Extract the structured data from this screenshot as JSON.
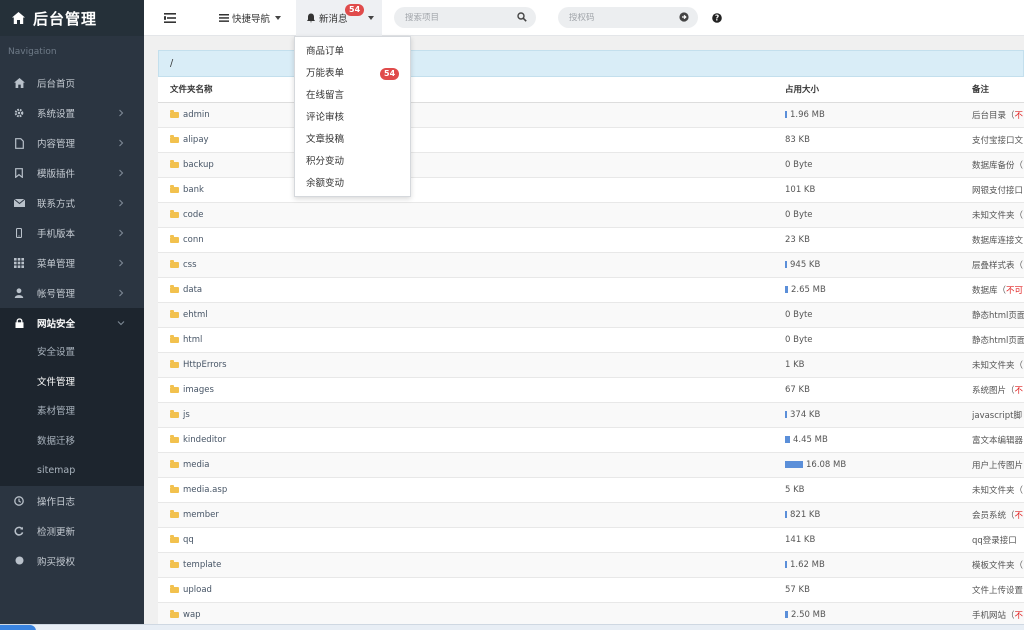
{
  "brand": {
    "title": "后台管理",
    "icon": "home-icon"
  },
  "sidebar": {
    "caption": "Navigation",
    "items": [
      {
        "label": "后台首页",
        "icon": "home-icon",
        "chevron": false
      },
      {
        "label": "系统设置",
        "icon": "gear-icon",
        "chevron": true
      },
      {
        "label": "内容管理",
        "icon": "document-icon",
        "chevron": true
      },
      {
        "label": "模版插件",
        "icon": "bookmark-icon",
        "chevron": true
      },
      {
        "label": "联系方式",
        "icon": "envelope-icon",
        "chevron": true
      },
      {
        "label": "手机版本",
        "icon": "mobile-icon",
        "chevron": true
      },
      {
        "label": "菜单管理",
        "icon": "grid-icon",
        "chevron": true
      },
      {
        "label": "帐号管理",
        "icon": "user-icon",
        "chevron": true
      },
      {
        "label": "网站安全",
        "icon": "lock-icon",
        "chevron": true,
        "active": true
      }
    ],
    "submenu": [
      {
        "label": "安全设置"
      },
      {
        "label": "文件管理",
        "current": true
      },
      {
        "label": "素材管理"
      },
      {
        "label": "数据迁移"
      },
      {
        "label": "sitemap"
      }
    ],
    "bottom_items": [
      {
        "label": "操作日志",
        "icon": "clock-icon"
      },
      {
        "label": "检测更新",
        "icon": "refresh-icon"
      },
      {
        "label": "购买授权",
        "icon": "circle-icon"
      }
    ]
  },
  "topbar": {
    "quicknav_label": "快捷导航",
    "messages_label": "新消息",
    "messages_count": "54",
    "search_placeholder": "搜索项目",
    "auth_placeholder": "授权码"
  },
  "dropdown": {
    "items": [
      {
        "label": "商品订单"
      },
      {
        "label": "万能表单",
        "badge": "54"
      },
      {
        "label": "在线留言"
      },
      {
        "label": "评论审核"
      },
      {
        "label": "文章投稿"
      },
      {
        "label": "积分变动"
      },
      {
        "label": "余额变动"
      }
    ]
  },
  "file_manager": {
    "path": "/",
    "columns": [
      "文件夹名称",
      "占用大小",
      "备注"
    ],
    "rows": [
      {
        "name": "admin",
        "size": "1.96 MB",
        "bar_mb": 1.96,
        "note": "后台目录（",
        "note_red": "不"
      },
      {
        "name": "alipay",
        "size": "83 KB",
        "bar_mb": 0,
        "note": "支付宝接口文",
        "note_red": ""
      },
      {
        "name": "backup",
        "size": "0 Byte",
        "bar_mb": 0,
        "note": "数据库备份（",
        "note_red": ""
      },
      {
        "name": "bank",
        "size": "101 KB",
        "bar_mb": 0,
        "note": "网银支付接口",
        "note_red": ""
      },
      {
        "name": "code",
        "size": "0 Byte",
        "bar_mb": 0,
        "note": "未知文件夹（",
        "note_red": ""
      },
      {
        "name": "conn",
        "size": "23 KB",
        "bar_mb": 0,
        "note": "数据库连接文",
        "note_red": ""
      },
      {
        "name": "css",
        "size": "945 KB",
        "bar_mb": 0.92,
        "note": "层叠样式表（",
        "note_red": ""
      },
      {
        "name": "data",
        "size": "2.65 MB",
        "bar_mb": 2.65,
        "note": "数据库（",
        "note_red": "不可"
      },
      {
        "name": "ehtml",
        "size": "0 Byte",
        "bar_mb": 0,
        "note": "静态html页面",
        "note_red": ""
      },
      {
        "name": "html",
        "size": "0 Byte",
        "bar_mb": 0,
        "note": "静态html页面",
        "note_red": ""
      },
      {
        "name": "HttpErrors",
        "size": "1 KB",
        "bar_mb": 0,
        "note": "未知文件夹（",
        "note_red": ""
      },
      {
        "name": "images",
        "size": "67 KB",
        "bar_mb": 0,
        "note": "系统图片（",
        "note_red": "不"
      },
      {
        "name": "js",
        "size": "374 KB",
        "bar_mb": 0.37,
        "note": "javascript脚",
        "note_red": ""
      },
      {
        "name": "kindeditor",
        "size": "4.45 MB",
        "bar_mb": 4.45,
        "note": "富文本编辑器",
        "note_red": ""
      },
      {
        "name": "media",
        "size": "16.08 MB",
        "bar_mb": 16.08,
        "note": "用户上传图片",
        "note_red": ""
      },
      {
        "name": "media.asp",
        "size": "5 KB",
        "bar_mb": 0,
        "note": "未知文件夹（",
        "note_red": ""
      },
      {
        "name": "member",
        "size": "821 KB",
        "bar_mb": 0.8,
        "note": "会员系统（",
        "note_red": "不"
      },
      {
        "name": "qq",
        "size": "141 KB",
        "bar_mb": 0,
        "note": "qq登录接口",
        "note_red": ""
      },
      {
        "name": "template",
        "size": "1.62 MB",
        "bar_mb": 1.62,
        "note": "模板文件夹（",
        "note_red": ""
      },
      {
        "name": "upload",
        "size": "57 KB",
        "bar_mb": 0,
        "note": "文件上传设置",
        "note_red": ""
      },
      {
        "name": "wap",
        "size": "2.50 MB",
        "bar_mb": 2.5,
        "note": "手机网站（",
        "note_red": "不"
      }
    ]
  },
  "colors": {
    "sidebar_bg": "#2b3541",
    "accent": "#5b8fd9",
    "badge": "#e04b4b",
    "path_bg": "#d9edf7"
  }
}
